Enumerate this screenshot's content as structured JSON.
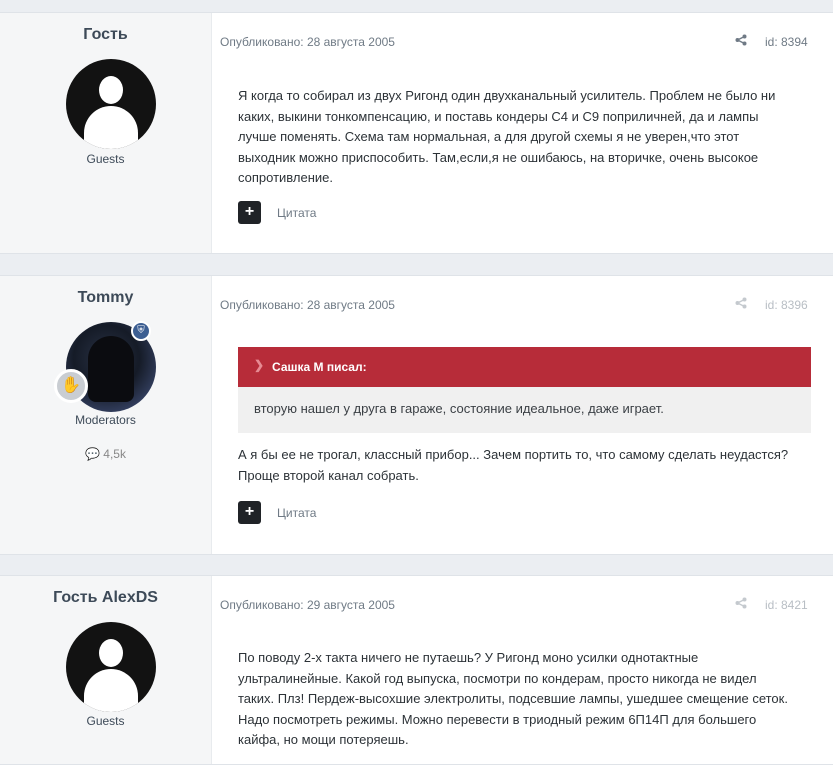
{
  "posts": [
    {
      "author": "Гость",
      "group": "Guests",
      "date": "Опубликовано: 28 августа 2005",
      "id": "id: 8394",
      "body": [
        "Я когда то собирал из двух Ригонд один двухканальный усилитель. Проблем не было ни",
        "каких, выкини тонкомпенсацию, и поставь кондеры С4 и С9 поприличней, да и лампы",
        "лучше поменять. Схема там нормальная, а для другой схемы я не уверен,что этот",
        "выходник можно приспособить. Там,если,я не ошибаюсь, на вторичке, очень высокое",
        "сопротивление."
      ],
      "quote_label": "Цитата"
    },
    {
      "author": "Tommy",
      "group": "Moderators",
      "reputation": "4,5k",
      "date": "Опубликовано: 28 августа 2005",
      "id": "id: 8396",
      "quote_author": "Сашка М писал:",
      "quote_text": "вторую нашел у друга в гараже, состояние идеальное, даже играет.",
      "body": [
        "А я бы ее не трогал, классный прибор... Зачем портить то, что самому сделать неудастся?",
        "Проще второй канал собрать."
      ],
      "quote_label": "Цитата"
    },
    {
      "author": "Гость AlexDS",
      "group": "Guests",
      "date": "Опубликовано: 29 августа 2005",
      "id": "id: 8421",
      "body": [
        "По поводу 2-х такта ничего не путаешь? У Ригонд моно усилки однотактные",
        "ультралинейные. Какой год выпуска, посмотри по кондерам, просто никогда не видел",
        "таких. Плз! Пердеж-высохшие электролиты, подсевшие лампы, ушедшее смещение сеток.",
        "Надо посмотреть режимы. Можно перевести в триодный режим 6П14П для большего",
        "кайфа, но мощи потеряешь."
      ]
    }
  ],
  "icons": {
    "share": "share-icon",
    "plus": "plus-icon",
    "chevron": "chevron-down-icon",
    "shield": "shield-icon",
    "hand": "hand-badge-icon",
    "comment": "comment-icon"
  }
}
